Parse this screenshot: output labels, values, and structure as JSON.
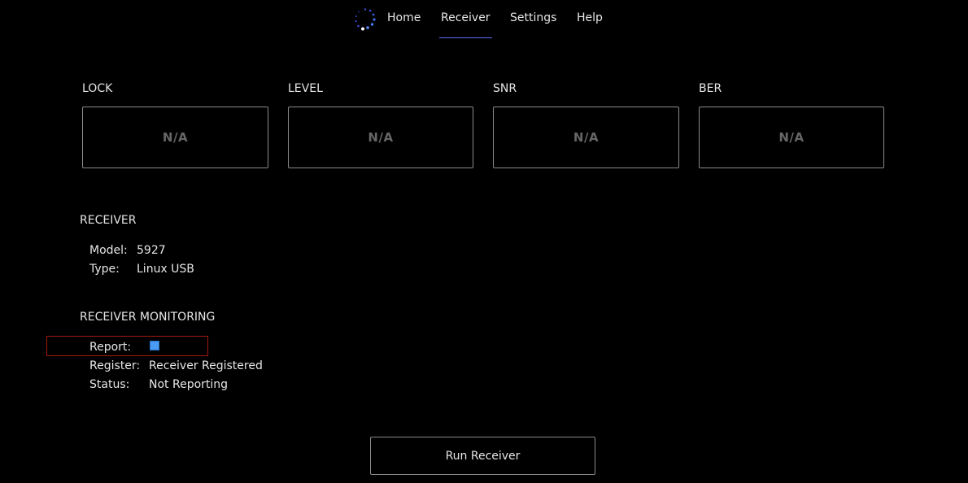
{
  "nav": {
    "items": [
      {
        "label": "Home"
      },
      {
        "label": "Receiver"
      },
      {
        "label": "Settings"
      },
      {
        "label": "Help"
      }
    ],
    "active": "Receiver",
    "accent_color": "#5b6ef0"
  },
  "metrics": [
    {
      "label": "LOCK",
      "value": "N/A"
    },
    {
      "label": "LEVEL",
      "value": "N/A"
    },
    {
      "label": "SNR",
      "value": "N/A"
    },
    {
      "label": "BER",
      "value": "N/A"
    }
  ],
  "receiver": {
    "title": "RECEIVER",
    "model_label": "Model:",
    "model_value": "5927",
    "type_label": "Type:",
    "type_value": "Linux USB"
  },
  "monitoring": {
    "title": "RECEIVER MONITORING",
    "report_label": "Report:",
    "report_checked": true,
    "register_label": "Register:",
    "register_value": "Receiver Registered",
    "status_label": "Status:",
    "status_value": "Not Reporting",
    "highlight_color": "#a11a0e"
  },
  "actions": {
    "run_label": "Run Receiver"
  }
}
